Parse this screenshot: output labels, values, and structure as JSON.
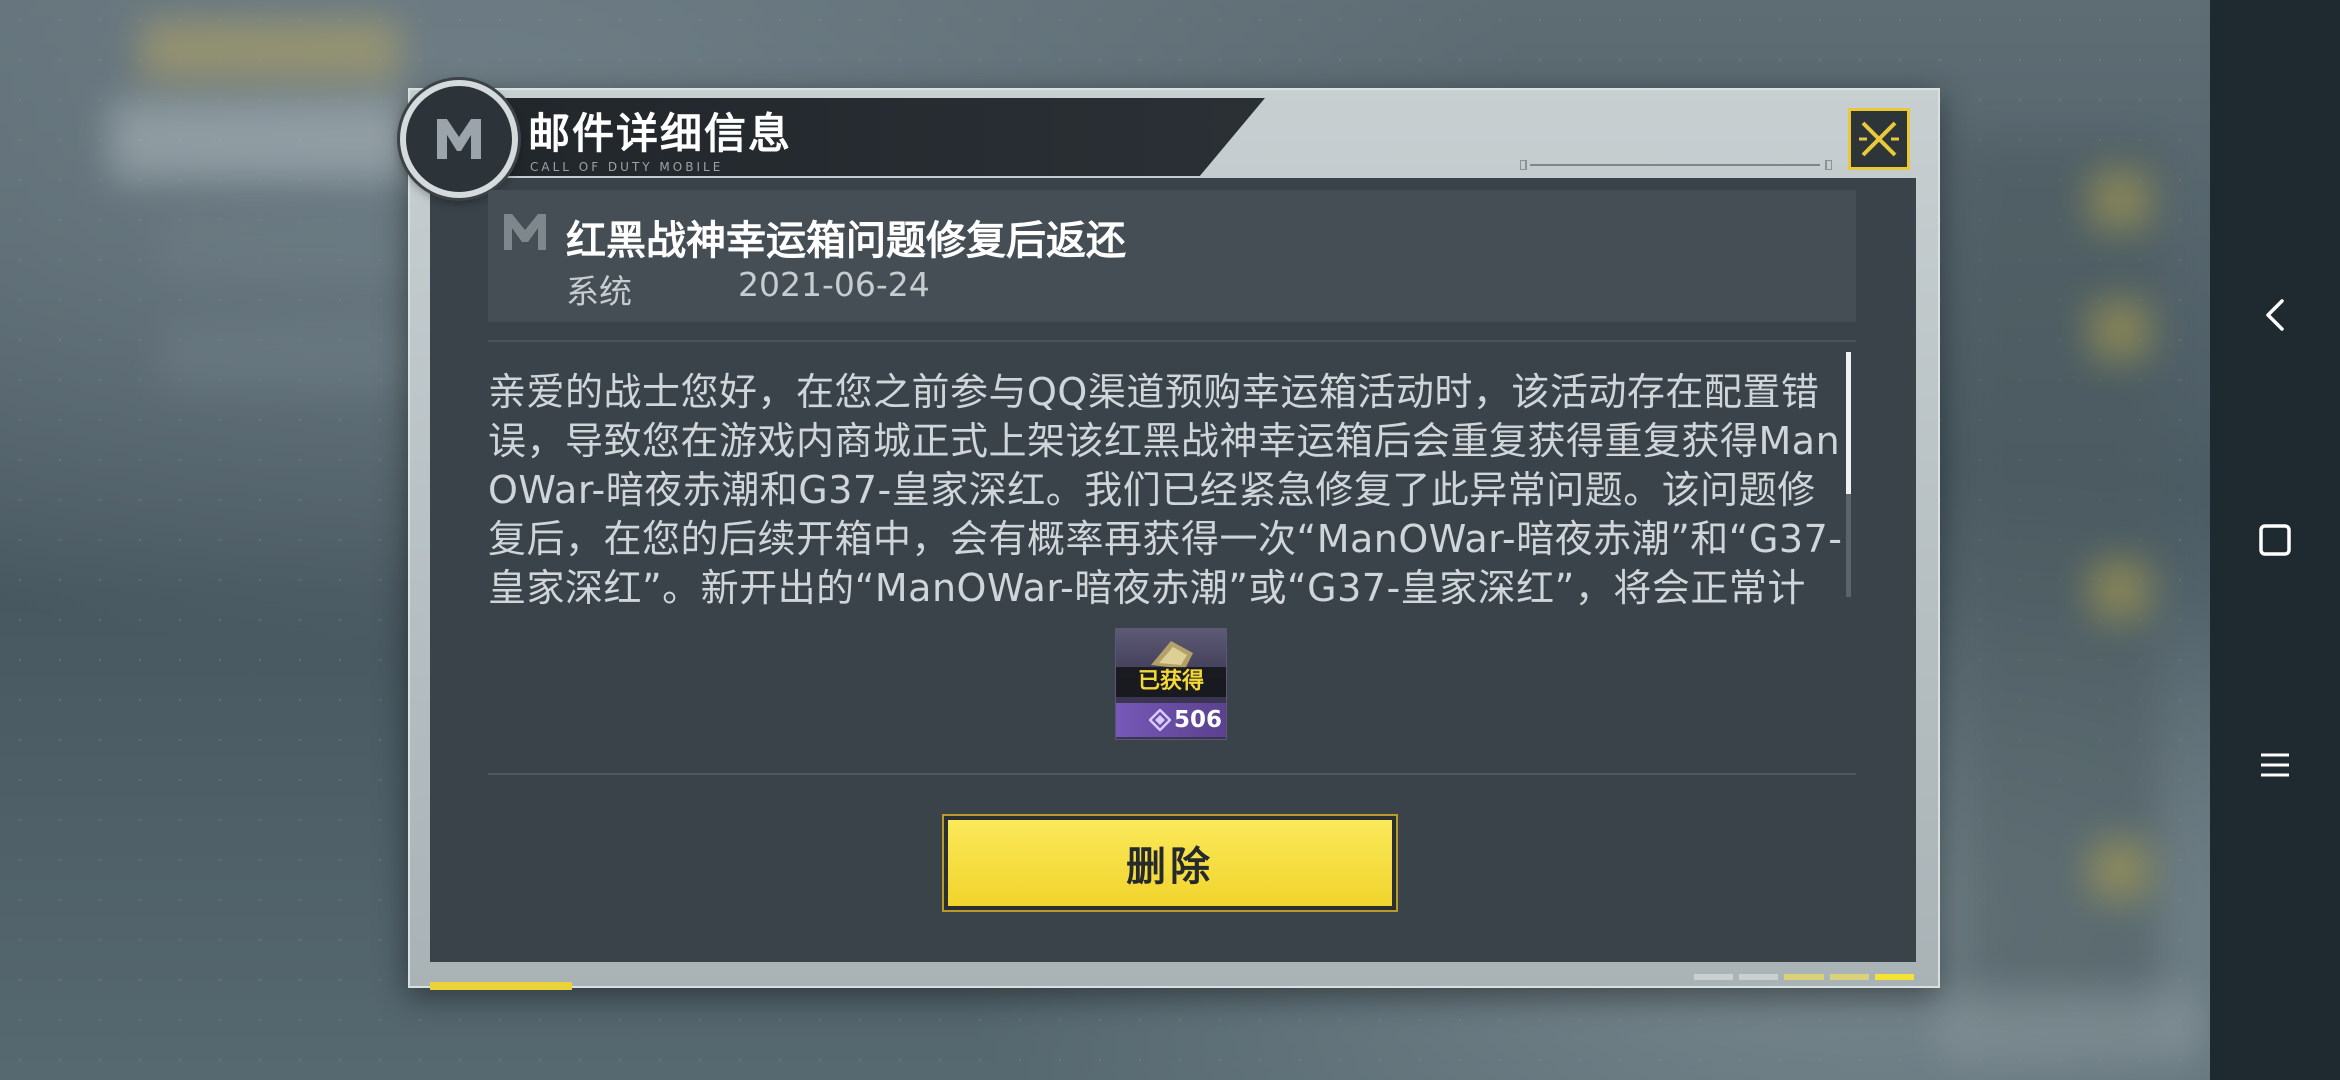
{
  "dialog": {
    "title": "邮件详细信息",
    "subtitle": "CALL OF DUTY MOBILE",
    "close_icon": "close-x-icon"
  },
  "mail": {
    "title": "红黑战神幸运箱问题修复后返还",
    "sender": "系统",
    "date": "2021-06-24",
    "body": "亲爱的战士您好，在您之前参与QQ渠道预购幸运箱活动时，该活动存在配置错误，导致您在游戏内商城正式上架该红黑战神幸运箱后会重复获得重复获得ManOWar-暗夜赤潮和G37-皇家深红。我们已经紧急修复了此异常问题。该问题修复后，在您的后续开箱中，会有概率再获得一次“ManOWar-暗夜赤潮”和“G37-皇家深红”。新开出的“ManOWar-暗夜赤潮”或“G37-皇家深红”，将会正常计入幸运箱的不重复获得统计，针对此"
  },
  "attachment": {
    "status": "已获得",
    "amount": "506",
    "currency_icon": "cod-points-icon"
  },
  "actions": {
    "delete_label": "删除"
  },
  "colors": {
    "accent_yellow": "#f3d836",
    "panel": "#3a4349",
    "frame": "#b8c1c4",
    "currency_purple": "#7658b8"
  },
  "nav": {
    "back_icon": "back-icon",
    "home_icon": "home-icon",
    "menu_icon": "menu-icon"
  }
}
